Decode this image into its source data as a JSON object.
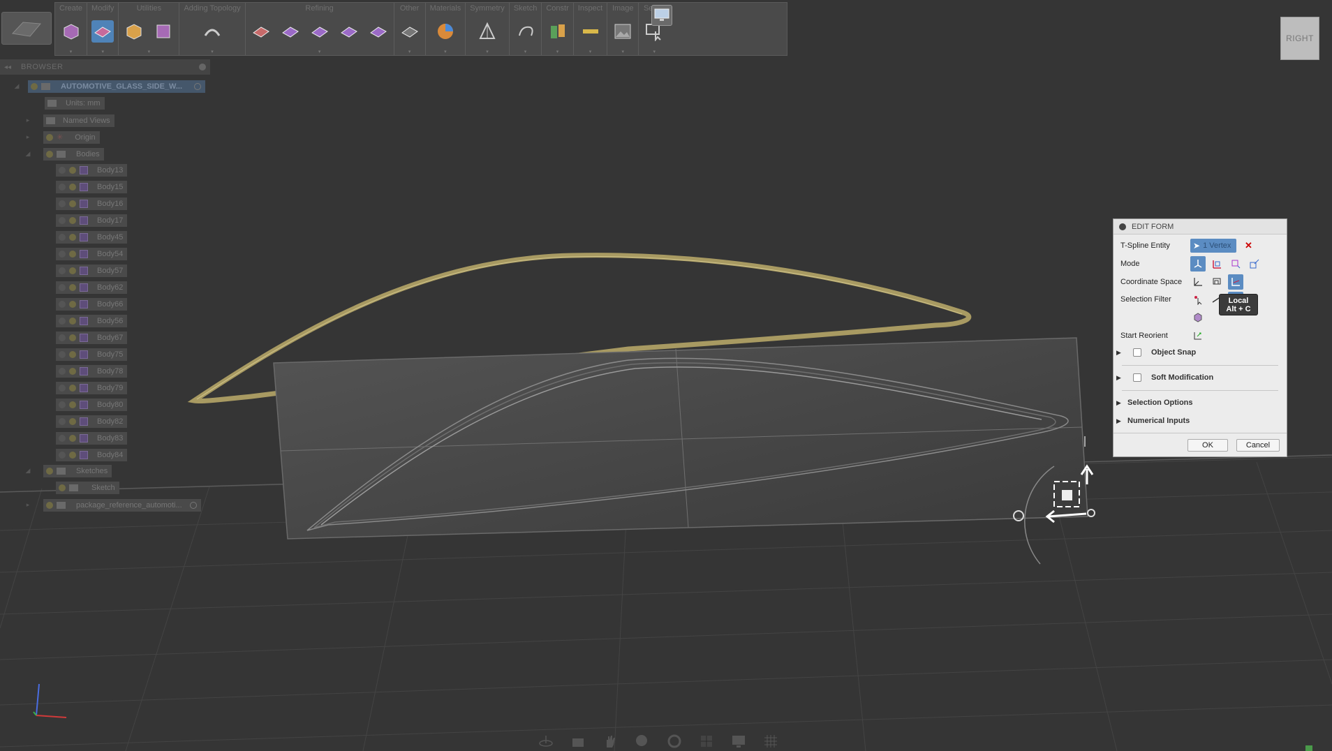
{
  "toolbar": {
    "groups": [
      {
        "label": "Create"
      },
      {
        "label": "Modify"
      },
      {
        "label": "Utilities"
      },
      {
        "label": "Adding Topology"
      },
      {
        "label": "Refining"
      },
      {
        "label": "Other"
      },
      {
        "label": "Materials"
      },
      {
        "label": "Symmetry"
      },
      {
        "label": "Sketch"
      },
      {
        "label": "Constr"
      },
      {
        "label": "Inspect"
      },
      {
        "label": "Image"
      },
      {
        "label": "Select"
      }
    ]
  },
  "browser": {
    "title": "BROWSER",
    "root": "AUTOMOTIVE_GLASS_SIDE_W...",
    "units": "Units: mm",
    "named_views": "Named Views",
    "origin": "Origin",
    "bodies": "Bodies",
    "body_items": [
      "Body13",
      "Body15",
      "Body16",
      "Body17",
      "Body45",
      "Body54",
      "Body57",
      "Body62",
      "Body66",
      "Body56",
      "Body67",
      "Body75",
      "Body78",
      "Body79",
      "Body80",
      "Body82",
      "Body83",
      "Body84"
    ],
    "sketches": "Sketches",
    "sketch_item": "Sketch",
    "reference": "package_reference_automoti..."
  },
  "viewcube": {
    "face": "RIGHT"
  },
  "dialog": {
    "title": "EDIT FORM",
    "tspline_label": "T-Spline Entity",
    "tspline_value": "1 Vertex",
    "mode_label": "Mode",
    "coord_label": "Coordinate Space",
    "filter_label": "Selection Filter",
    "reorient_label": "Start Reorient",
    "object_snap": "Object Snap",
    "soft_mod": "Soft Modification",
    "selection_options": "Selection Options",
    "numerical_inputs": "Numerical Inputs",
    "ok": "OK",
    "cancel": "Cancel"
  },
  "tooltip": {
    "line1": "Local",
    "line2": "Alt + C"
  },
  "colors": {
    "accent": "#5b8cc2",
    "background": "#353535",
    "glass_edge": "#b8a76a"
  }
}
